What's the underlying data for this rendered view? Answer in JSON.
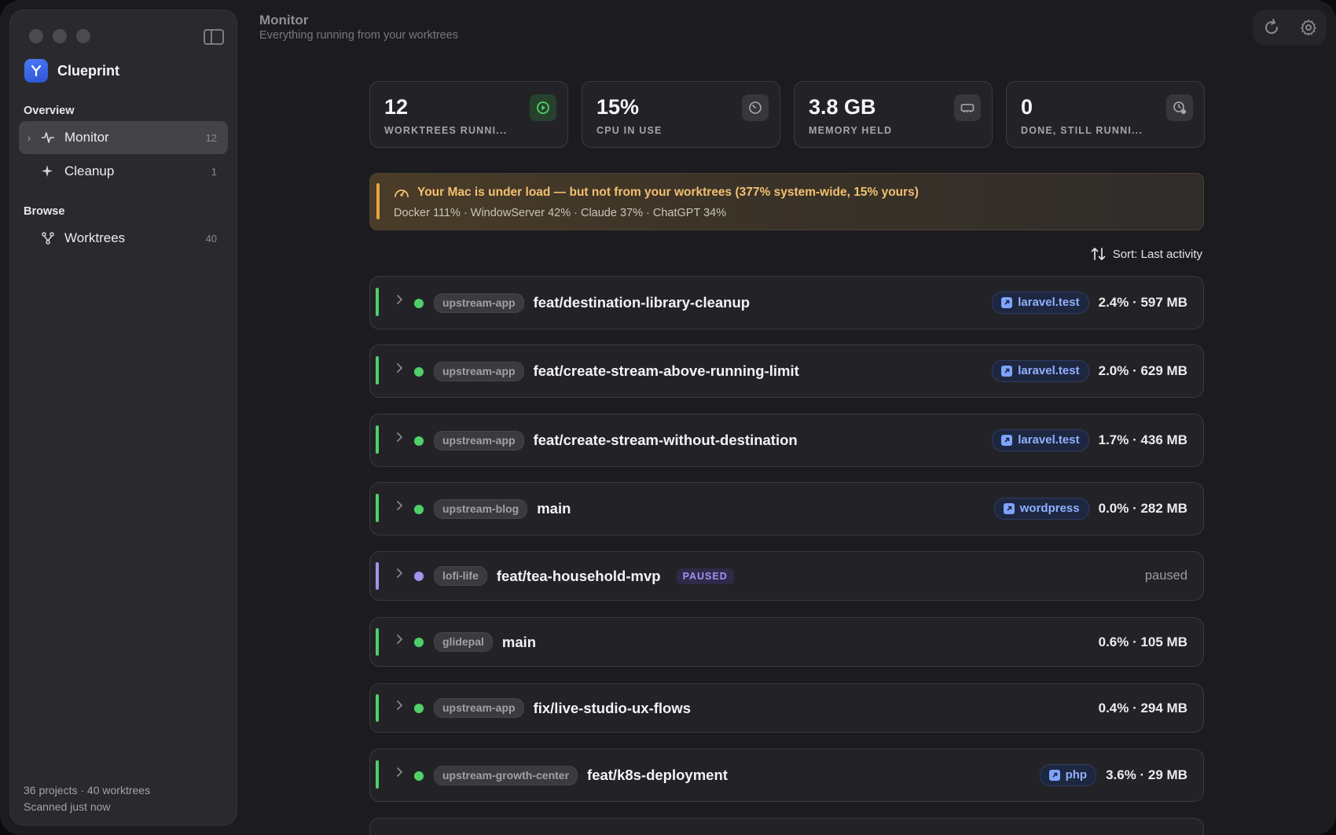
{
  "app": {
    "name": "Clueprint"
  },
  "sidebar": {
    "sections": [
      {
        "label": "Overview"
      },
      {
        "label": "Browse"
      }
    ],
    "items": [
      {
        "label": "Monitor",
        "count": "12",
        "icon": "activity-icon"
      },
      {
        "label": "Cleanup",
        "count": "1",
        "icon": "sparkle-icon"
      },
      {
        "label": "Worktrees",
        "count": "40",
        "icon": "git-branch-icon"
      }
    ],
    "footer": {
      "line1": "36 projects · 40 worktrees",
      "line2": "Scanned just now"
    }
  },
  "header": {
    "title": "Monitor",
    "subtitle": "Everything running from your worktrees"
  },
  "stats": [
    {
      "value": "12",
      "label": "WORKTREES RUNNI...",
      "icon": "play-circle-icon"
    },
    {
      "value": "15%",
      "label": "CPU IN USE",
      "icon": "gauge-icon"
    },
    {
      "value": "3.8 GB",
      "label": "MEMORY HELD",
      "icon": "memory-icon"
    },
    {
      "value": "0",
      "label": "DONE, STILL RUNNI...",
      "icon": "clock-alert-icon"
    }
  ],
  "alert": {
    "title": "Your Mac is under load — but not from your worktrees (377% system-wide, 15% yours)",
    "detail": "Docker 111% · WindowServer 42% · Claude 37% · ChatGPT 34%"
  },
  "sort": {
    "label": "Sort: Last activity"
  },
  "rows": [
    {
      "project": "upstream-app",
      "branch": "feat/destination-library-cleanup",
      "site": "laravel.test",
      "metrics": "2.4% · 597 MB",
      "status": "running"
    },
    {
      "project": "upstream-app",
      "branch": "feat/create-stream-above-running-limit",
      "site": "laravel.test",
      "metrics": "2.0% · 629 MB",
      "status": "running"
    },
    {
      "project": "upstream-app",
      "branch": "feat/create-stream-without-destination",
      "site": "laravel.test",
      "metrics": "1.7% · 436 MB",
      "status": "running"
    },
    {
      "project": "upstream-blog",
      "branch": "main",
      "site": "wordpress",
      "metrics": "0.0% · 282 MB",
      "status": "running"
    },
    {
      "project": "lofi-life",
      "branch": "feat/tea-household-mvp",
      "badge": "PAUSED",
      "paused_text": "paused",
      "status": "paused"
    },
    {
      "project": "glidepal",
      "branch": "main",
      "metrics": "0.6% · 105 MB",
      "status": "running"
    },
    {
      "project": "upstream-app",
      "branch": "fix/live-studio-ux-flows",
      "metrics": "0.4% · 294 MB",
      "status": "running"
    },
    {
      "project": "upstream-growth-center",
      "branch": "feat/k8s-deployment",
      "site": "php",
      "metrics": "3.6% · 29 MB",
      "status": "running"
    }
  ],
  "colors": {
    "running": "#4fd06a",
    "paused": "#a491f0",
    "warning": "#e9a43c",
    "link": "#8fb0ff"
  }
}
